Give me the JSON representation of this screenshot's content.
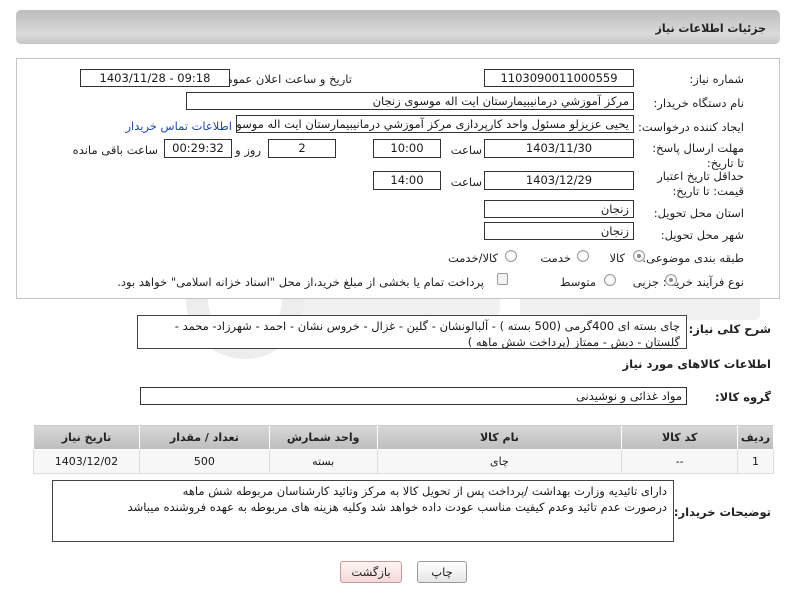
{
  "header": {
    "title": "جزئیات اطلاعات نیاز"
  },
  "fields": {
    "need_number_label": "شماره نیاز:",
    "need_number": "1103090011000559",
    "announce_label": "تاریخ و ساعت اعلان عمومی:",
    "announce_value": "1403/11/28 - 09:18",
    "buyer_org_label": "نام دستگاه خریدار:",
    "buyer_org": "مرکز آموزشي درمانيبيمارستان ايت اله موسوی زنجان",
    "creator_label": "ایجاد کننده درخواست:",
    "creator": "یحیی عزیزلو مسئول واحد کارپردازی مرکز آموزشي درمانيبيمارستان ايت اله موسوی",
    "contact_link": "اطلاعات تماس خریدار",
    "deadline_label": "مهلت ارسال پاسخ: تا تاریخ:",
    "deadline_date": "1403/11/30",
    "time_label": "ساعت",
    "deadline_time": "10:00",
    "days_value": "2",
    "days_label": "روز و",
    "remaining_time": "00:29:32",
    "remaining_label": "ساعت باقی مانده",
    "validity_label": "حداقل تاریخ اعتبار قیمت: تا تاریخ:",
    "validity_date": "1403/12/29",
    "validity_time_label": "ساعت",
    "validity_time": "14:00",
    "province_label": "استان محل تحویل:",
    "province": "زنجان",
    "city_label": "شهر محل تحویل:",
    "city": "زنجان",
    "category_label": "طبقه بندی موضوعی:",
    "category_options": [
      "کالا",
      "خدمت",
      "کالا/خدمت"
    ],
    "process_label": "نوع فرآیند خرید :",
    "process_options": [
      "جزیی",
      "متوسط"
    ],
    "payment_note": "پرداخت تمام یا بخشی از مبلغ خرید،از محل \"اسناد خزانه اسلامی\" خواهد بود."
  },
  "description": {
    "label": "شرح کلی نیاز:",
    "text": "چای بسته ای 400گرمی (500 بسته ) - آلبالونشان - گلین - غزال - خروس نشان - احمد - شهرزاد- محمد - گلستان - دبش - ممتاز (پرداخت شش ماهه )"
  },
  "goods": {
    "section_title": "اطلاعات کالاهای مورد نیاز",
    "group_label": "گروه کالا:",
    "group_value": "مواد غذائی و نوشیدنی",
    "columns": [
      "ردیف",
      "کد کالا",
      "نام کالا",
      "واحد شمارش",
      "تعداد / مقدار",
      "تاریخ نیاز"
    ],
    "rows": [
      {
        "index": "1",
        "code": "--",
        "name": "چای",
        "unit": "بسته",
        "qty": "500",
        "date": "1403/12/02"
      }
    ]
  },
  "buyer_notes": {
    "label": "توضیحات خریدار:",
    "line1": "دارای تائیدیه وزارت بهداشت /پرداخت پس از تحویل کالا به مرکز وتائید کارشناسان مربوطه شش ماهه",
    "line2": "درصورت عدم تائید وعدم کیفیت مناسب عودت داده خواهد شد وکلیه هزینه های مربوطه به عهده فروشنده میباشد"
  },
  "buttons": {
    "print": "چاپ",
    "back": "بازگشت"
  },
  "colors": {
    "header_bg": "#c9c9c9",
    "link": "#1f47b5",
    "back_button_bg": "#fbe7e7"
  }
}
